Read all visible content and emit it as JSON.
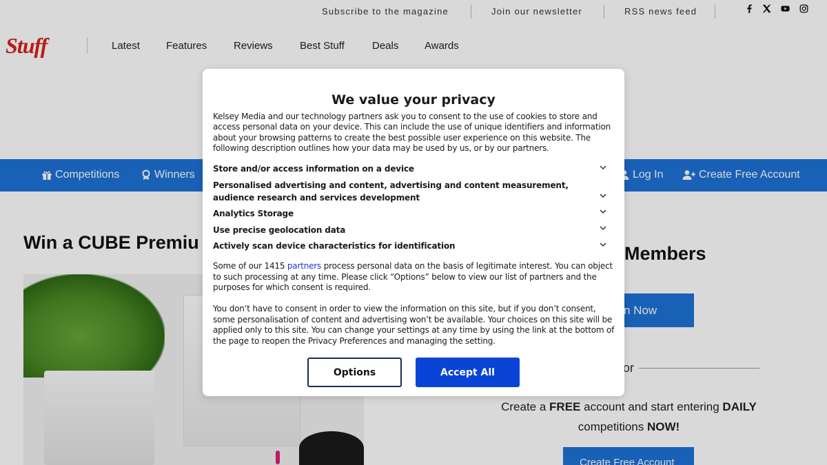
{
  "topbar": {
    "links": [
      "Subscribe to the magazine",
      "Join our newsletter",
      "RSS news feed"
    ],
    "social": [
      "facebook-icon",
      "x-icon",
      "youtube-icon",
      "instagram-icon"
    ]
  },
  "logo": {
    "text": "Stuff"
  },
  "nav": {
    "items": [
      "Latest",
      "Features",
      "Reviews",
      "Best Stuff",
      "Deals",
      "Awards"
    ]
  },
  "bluebar": {
    "left": [
      {
        "label": "Competitions",
        "icon": "gift-icon"
      },
      {
        "label": "Winners",
        "icon": "ribbon-icon"
      }
    ],
    "right": [
      {
        "label": "Log In",
        "icon": "user-icon"
      },
      {
        "label": "Create Free Account",
        "icon": "user-plus-icon"
      }
    ]
  },
  "main": {
    "title": "Win a CUBE Premiu",
    "members_title": "Members",
    "join_button": "n Now",
    "or_text": "or",
    "promo": {
      "p1": "Create a ",
      "free": "FREE",
      "p2": " account and start entering ",
      "daily": "DAILY",
      "p3": "competitions ",
      "now": "NOW!"
    },
    "create_button": "Create Free Account"
  },
  "consent": {
    "title": "We value your privacy",
    "intro": "Kelsey Media and our technology partners ask you to consent to the use of cookies to store and access personal data on your device. This can include the use of unique identifiers and information about your browsing patterns to create the best possible user experience on this website. The following description outlines how your data may be used by us, or by our partners.",
    "purposes": [
      "Store and/or access information on a device",
      "Personalised advertising and content, advertising and content measurement, audience research and services development",
      "Analytics Storage",
      "Use precise geolocation data",
      "Actively scan device characteristics for identification"
    ],
    "legit_before": "Some of our 1415 ",
    "legit_link": "partners",
    "legit_after": " process personal data on the basis of legitimate interest. You can object to such processing at any time. Please click “Options” below to view our list of partners and the purposes for which consent is required.",
    "notice": "You don’t have to consent in order to view the information on this site, but if you don’t consent, some personalisation of content and advertising won’t be available. Your choices on this site will be applied only to this site. You can change your settings at any time by using the link at the bottom of the page to reopen the Privacy Preferences and managing the setting.",
    "options_label": "Options",
    "accept_label": "Accept All",
    "accent_color": "#0a44d6"
  }
}
